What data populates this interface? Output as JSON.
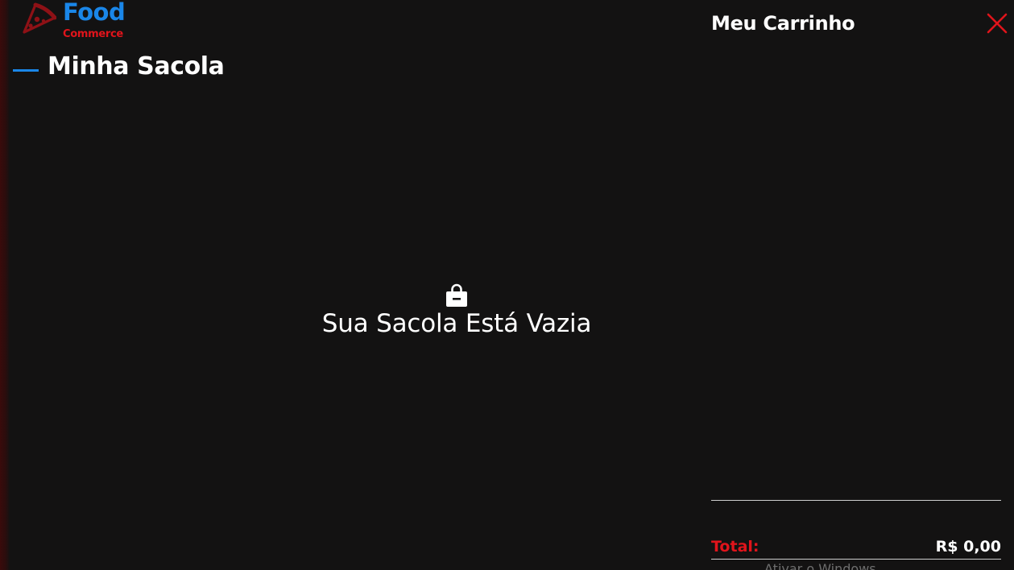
{
  "brand": {
    "name": "Food",
    "subtitle": "Commerce",
    "icon": "pizza-slice-icon",
    "primary_color": "#1a86e8",
    "accent_color": "#e0141b"
  },
  "main": {
    "title": "Minha Sacola",
    "empty_icon": "shopping-bag-icon",
    "empty_message": "Sua Sacola Está Vazia"
  },
  "cart": {
    "title": "Meu Carrinho",
    "close_icon": "close-icon",
    "total_label": "Total:",
    "total_value": "R$ 0,00"
  },
  "os_watermark": {
    "text": "Ativar o Windows"
  },
  "colors": {
    "background": "#131212",
    "text": "#ffffff"
  }
}
